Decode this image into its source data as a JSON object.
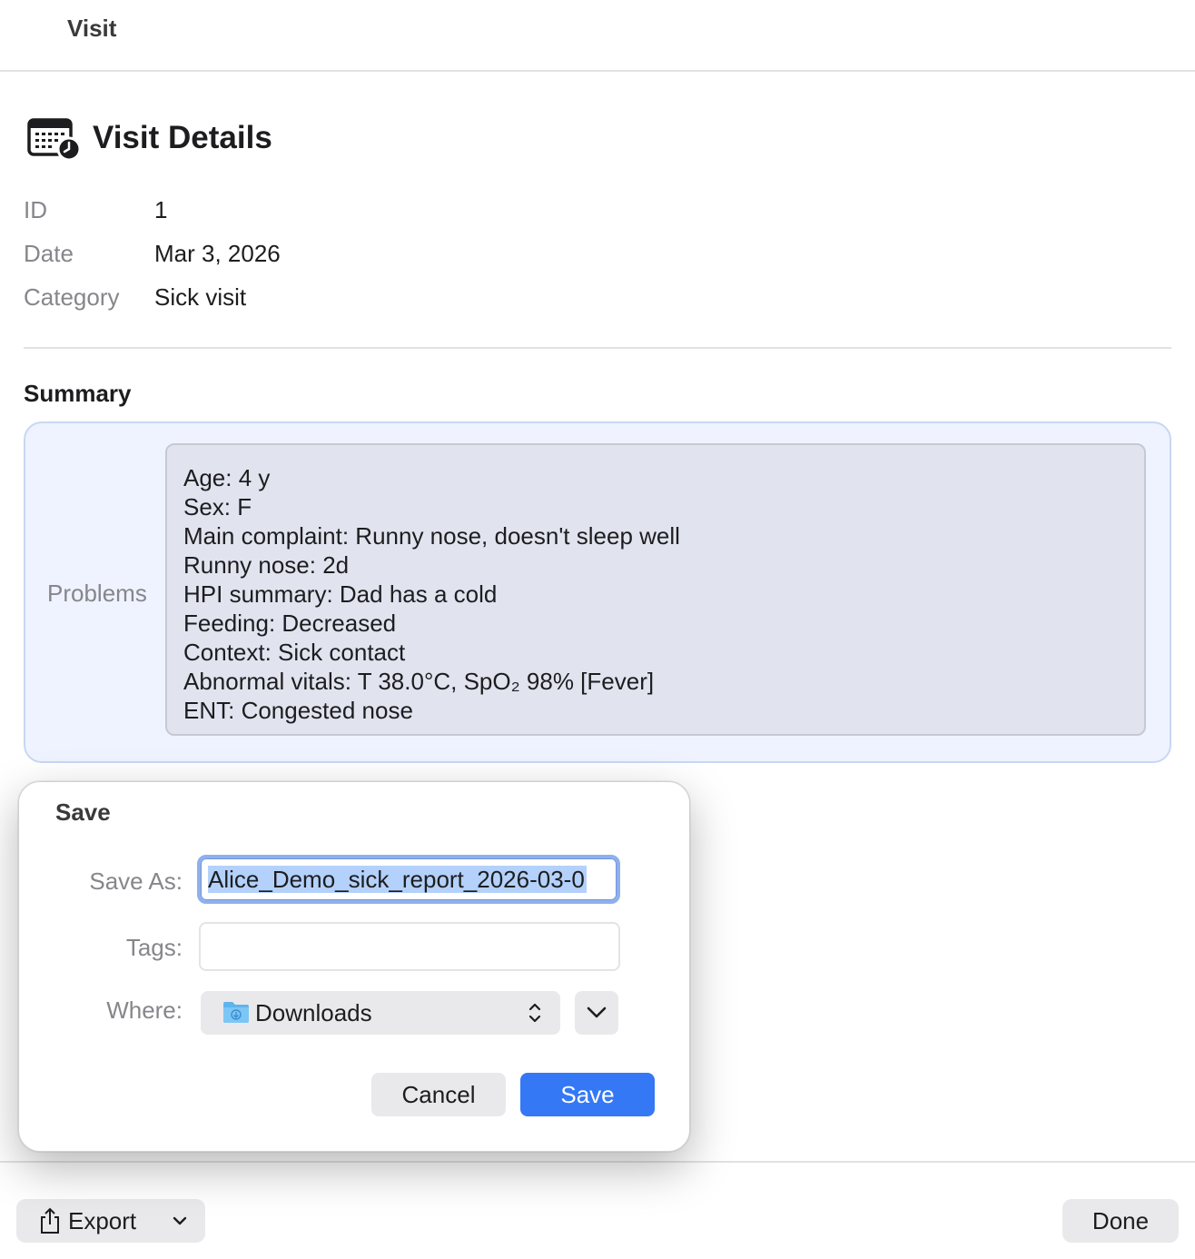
{
  "window": {
    "title": "Visit"
  },
  "header": {
    "title": "Visit Details",
    "icon": "calendar-clock-icon"
  },
  "details": [
    {
      "label": "ID",
      "value": "1"
    },
    {
      "label": "Date",
      "value": "Mar 3, 2026"
    },
    {
      "label": "Category",
      "value": "Sick visit"
    }
  ],
  "summary": {
    "title": "Summary",
    "problems_label": "Problems",
    "lines": [
      "Age: 4 y",
      "Sex: F",
      "Main complaint: Runny nose, doesn't sleep well",
      "Runny nose: 2d",
      "HPI summary: Dad has a cold",
      "Feeding: Decreased",
      "Context: Sick contact",
      "Abnormal vitals: T 38.0°C, SpO₂ 98% [Fever]",
      "ENT: Congested nose"
    ]
  },
  "footer": {
    "export_label": "Export",
    "export_icon": "share-icon",
    "done_label": "Done"
  },
  "save_dialog": {
    "title": "Save",
    "save_as_label": "Save As:",
    "save_as_value": "Alice_Demo_sick_report_2026-03-0",
    "tags_label": "Tags:",
    "tags_value": "",
    "where_label": "Where:",
    "where_value": "Downloads",
    "where_icon": "downloads-folder-icon",
    "cancel_label": "Cancel",
    "save_label": "Save",
    "accent_color": "#3478f6"
  }
}
